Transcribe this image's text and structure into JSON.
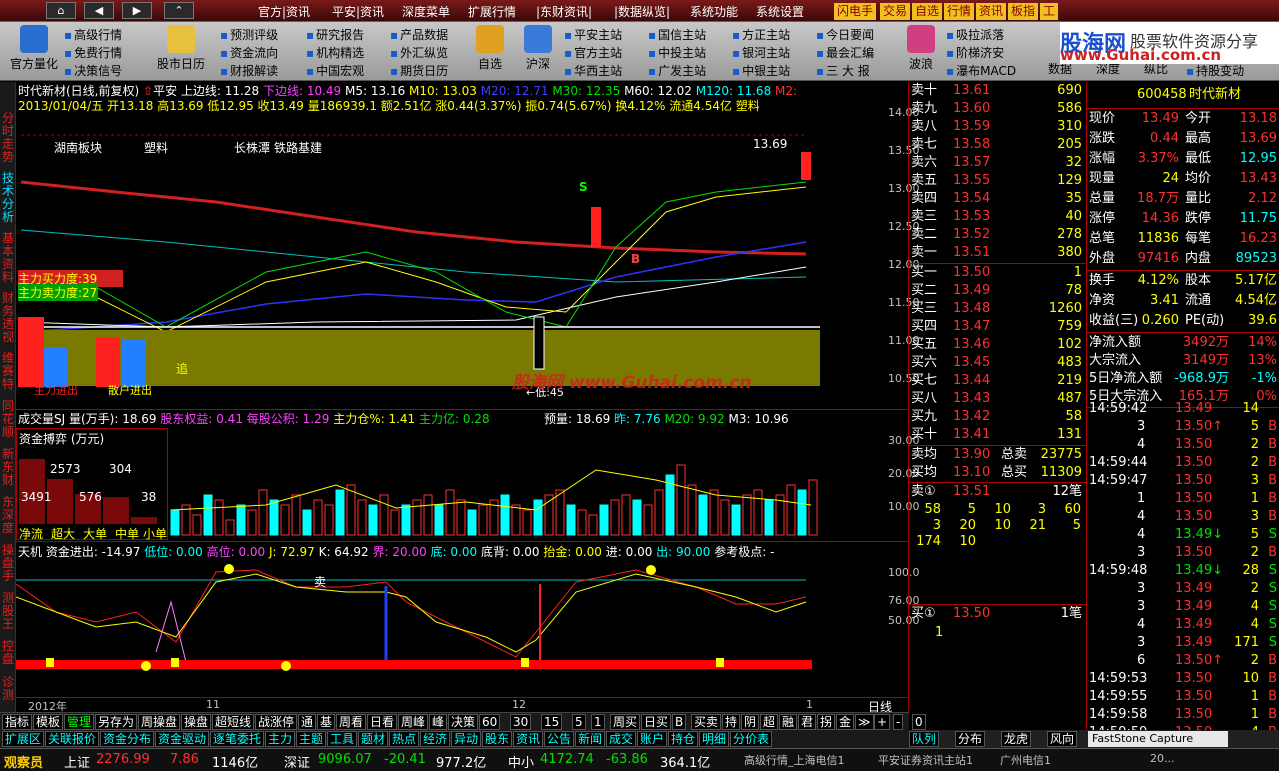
{
  "topbar": {
    "nav": [
      "⌂",
      "◀",
      "▶",
      "⌃"
    ],
    "menus": [
      "官方|资讯",
      "平安|资讯",
      "深度菜单",
      "扩展行情",
      "|东财资讯|",
      "|数据纵览|",
      "系统功能",
      "系统设置"
    ],
    "yellow": [
      "闪电手",
      "交易",
      "自选",
      "行情",
      "资讯",
      "板指",
      "工"
    ]
  },
  "logo": {
    "brand": "股海网",
    "slogan": "股票软件资源分享",
    "url": "www.Guhai.com.cn"
  },
  "toolbar": {
    "big": [
      "官方量化",
      "股市日历",
      "自选",
      "沪深",
      "波浪",
      "数据",
      "深度",
      "纵比"
    ],
    "links": [
      "高级行情",
      "免费行情",
      "决策信号",
      "预测评级",
      "资金流向",
      "财报解读",
      "研究报告",
      "机构精选",
      "中国宏观",
      "产品数据",
      "外汇纵览",
      "期货日历",
      "平安主站",
      "官方主站",
      "华西主站",
      "国信主站",
      "中投主站",
      "广发主站",
      "方正主站",
      "银河主站",
      "中银主站",
      "今日要闻",
      "最会汇编",
      "三 大 报",
      "吸拉派落",
      "阶梯济安",
      "瀑布MACD",
      "持股变动"
    ]
  },
  "lefttabs": [
    "分时走势",
    "技术分析",
    "基本资料",
    "财务透视",
    "维赛特",
    "同花顺",
    "新东财",
    "东深度",
    "操盘手",
    "测股王",
    "控盘",
    "诊测"
  ],
  "kline": {
    "line1": "时代新材(日线,前复权)",
    "ping": "平安",
    "upper": "上边线: 11.28",
    "lower": "下边线: 10.49",
    "ma5": "M5: 13.16",
    "ma10": "M10: 13.03",
    "ma20": "M20: 12.71",
    "ma30": "M30: 12.35",
    "ma60": "M60: 12.02",
    "ma120": "M120: 11.68",
    "m2": "M2:",
    "line2": "2013/01/04/五 开13.18 高13.69 低12.95 收13.49 量186939.1 额2.51亿 涨0.44(3.37%) 振0.74(5.67%) 换4.12% 流通4.54亿 塑料",
    "tags": [
      "湖南板块",
      "塑料",
      "长株潭",
      "铁路基建"
    ],
    "hi": "13.69",
    "lo": "←低:45",
    "buy": "主力买力度:39",
    "sell": "主力卖力度:27",
    "zhui": "追",
    "s": "S",
    "b": "B",
    "main_in": "主力进出",
    "sh_in": "散户进出",
    "wm": "股海网 www.Guhai.com.cn",
    "yticks": [
      "14.00",
      "13.50",
      "13.00",
      "12.50",
      "12.00",
      "11.50",
      "11.00",
      "10.50"
    ]
  },
  "vol": {
    "line": "成交量SJ 量(万手): 18.69",
    "gd": "股东权益: 0.41",
    "mg": "每股公积: 1.29",
    "zl": "主力仓%: 1.41",
    "zly": "主力亿: 0.28",
    "yl": "预量: 18.69",
    "zuo": "昨: 7.76",
    "m20": "M20: 9.92",
    "m3": "M3: 10.96",
    "box": "资金搏弈 (万元)",
    "n1": "2573",
    "n2": "304",
    "n3": "3491",
    "n4": "576",
    "n5": "38",
    "labels": [
      "净流",
      "超大",
      "大单",
      "中单",
      "小单"
    ],
    "yticks": [
      "30.00",
      "20.00",
      "10.00"
    ]
  },
  "ind": {
    "line": "天机 资金进出: -14.97",
    "a": "低位: 0.00",
    "b": "高位: 0.00",
    "c": "J: 72.97",
    "d": "K: 64.92",
    "e": "界: 20.00",
    "f": "底: 0.00",
    "g": "底背: 0.00",
    "h": "抬金: 0.00",
    "i": "进: 0.00",
    "j": "出: 90.00",
    "k": "参考极点: -",
    "mai": "卖",
    "yticks": [
      "100.0",
      "76.00",
      "50.00"
    ]
  },
  "xaxis": [
    "2012年",
    "11",
    "12",
    "1"
  ],
  "xlabel": "日线",
  "quote": {
    "code": "600458",
    "name": "时代新材",
    "sells": [
      [
        "卖十",
        "13.61",
        "690"
      ],
      [
        "卖九",
        "13.60",
        "586"
      ],
      [
        "卖八",
        "13.59",
        "310"
      ],
      [
        "卖七",
        "13.58",
        "205"
      ],
      [
        "卖六",
        "13.57",
        "32"
      ],
      [
        "卖五",
        "13.55",
        "129"
      ],
      [
        "卖四",
        "13.54",
        "35"
      ],
      [
        "卖三",
        "13.53",
        "40"
      ],
      [
        "卖二",
        "13.52",
        "278"
      ],
      [
        "卖一",
        "13.51",
        "380"
      ]
    ],
    "buys": [
      [
        "买一",
        "13.50",
        "1"
      ],
      [
        "买二",
        "13.49",
        "78"
      ],
      [
        "买三",
        "13.48",
        "1260"
      ],
      [
        "买四",
        "13.47",
        "759"
      ],
      [
        "买五",
        "13.46",
        "102"
      ],
      [
        "买六",
        "13.45",
        "483"
      ],
      [
        "买七",
        "13.44",
        "219"
      ],
      [
        "买八",
        "13.43",
        "487"
      ],
      [
        "买九",
        "13.42",
        "58"
      ],
      [
        "买十",
        "13.41",
        "131"
      ]
    ],
    "avg": [
      [
        "卖均",
        "13.90",
        "总卖",
        "23775"
      ],
      [
        "买均",
        "13.10",
        "总买",
        "11309"
      ]
    ],
    "q1": {
      "label": "卖①",
      "price": "13.51",
      "cnt": "12笔",
      "rows": [
        [
          "58",
          "5",
          "10",
          "3",
          "60"
        ],
        [
          "3",
          "20",
          "10",
          "21",
          "5"
        ],
        [
          "174",
          "10",
          "",
          "",
          ""
        ]
      ]
    },
    "q2": {
      "label": "买①",
      "price": "13.50",
      "cnt": "1笔",
      "rows": [
        [
          "1"
        ]
      ]
    }
  },
  "stats": [
    [
      "现价",
      "13.49",
      "今开",
      "13.18"
    ],
    [
      "涨跌",
      "0.44",
      "最高",
      "13.69"
    ],
    [
      "涨幅",
      "3.37%",
      "最低",
      "12.95"
    ],
    [
      "现量",
      "24",
      "均价",
      "13.43"
    ],
    [
      "总量",
      "18.7万",
      "量比",
      "2.12"
    ],
    [
      "涨停",
      "14.36",
      "跌停",
      "11.75"
    ],
    [
      "总笔",
      "11836",
      "每笔",
      "16.23"
    ],
    [
      "外盘",
      "97416",
      "内盘",
      "89523"
    ]
  ],
  "stats2": [
    [
      "换手",
      "4.12%",
      "股本",
      "5.17亿"
    ],
    [
      "净资",
      "3.41",
      "流通",
      "4.54亿"
    ],
    [
      "收益(三)",
      "0.260",
      "PE(动)",
      "39.6"
    ]
  ],
  "flows": [
    [
      "净流入额",
      "3492万",
      "14%"
    ],
    [
      "大宗流入",
      "3149万",
      "13%"
    ],
    [
      "5日净流入额",
      "-968.9万",
      "-1%"
    ],
    [
      "5日大宗流入",
      "165.1万",
      "0%"
    ]
  ],
  "ticks": [
    [
      "14:59:42",
      "13.49",
      "14",
      ""
    ],
    [
      "3",
      "13.50↑",
      "5",
      "B"
    ],
    [
      "4",
      "13.50",
      "2",
      "B"
    ],
    [
      "14:59:44",
      "13.50",
      "2",
      "B"
    ],
    [
      "14:59:47",
      "13.50",
      "3",
      "B"
    ],
    [
      "1",
      "13.50",
      "1",
      "B"
    ],
    [
      "4",
      "13.50",
      "3",
      "B"
    ],
    [
      "4",
      "13.49↓",
      "5",
      "S"
    ],
    [
      "3",
      "13.50",
      "2",
      "B"
    ],
    [
      "14:59:48",
      "13.49↓",
      "28",
      "S"
    ],
    [
      "3",
      "13.49",
      "2",
      "S"
    ],
    [
      "3",
      "13.49",
      "4",
      "S"
    ],
    [
      "4",
      "13.49",
      "4",
      "S"
    ],
    [
      "3",
      "13.49",
      "171",
      "S"
    ],
    [
      "6",
      "13.50↑",
      "2",
      "B"
    ],
    [
      "14:59:53",
      "13.50",
      "10",
      "B"
    ],
    [
      "14:59:55",
      "13.50",
      "1",
      "B"
    ],
    [
      "14:59:58",
      "13.50",
      "1",
      "B"
    ],
    [
      "14:59:59",
      "13.50",
      "4",
      "B"
    ]
  ],
  "bottabs": [
    "指标",
    "模板",
    "管理",
    "另存为",
    "周操盘",
    "操盘",
    "超短线",
    "战涨停",
    "通",
    "基",
    "周看",
    "日看",
    "周峰",
    "峰",
    "决策",
    "60",
    "30",
    "15",
    "5",
    "1",
    "周买",
    "日买",
    "B",
    "买卖",
    "持",
    "阴",
    "超",
    "融",
    "君",
    "拐",
    "金",
    "≫",
    "+",
    "-",
    "0"
  ],
  "bottabs2": [
    "扩展区",
    "关联报价",
    "资金分布",
    "资金驱动",
    "逐笔委托",
    "主力",
    "主题",
    "工具",
    "题材",
    "热点",
    "经济",
    "异动",
    "股东",
    "资讯",
    "公告",
    "新闻",
    "成交",
    "账户",
    "持仓",
    "明细",
    "分价表"
  ],
  "rtabs": [
    "队列",
    "分布",
    "龙虎",
    "风向"
  ],
  "status": {
    "watcher": "观察员",
    "sh": "上证",
    "sh_v": "2276.99",
    "sh_c": "7.86",
    "sh_a": "1146亿",
    "sz": "深证",
    "sz_v": "9096.07",
    "sz_c": "-20.41",
    "sz_a": "977.2亿",
    "zx": "中小",
    "zx_v": "4172.74",
    "zx_c": "-63.86",
    "zx_a": "364.1亿",
    "server": "高级行情_上海电信1",
    "server2": "平安证券资讯主站1",
    "server3": "广州电信1",
    "fs": "FastStone Capture",
    "num": "20..."
  }
}
